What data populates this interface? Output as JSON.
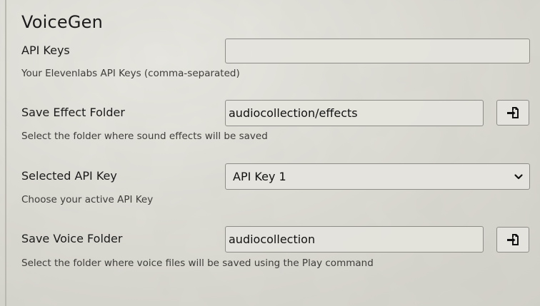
{
  "section": {
    "title": "VoiceGen"
  },
  "settings": [
    {
      "label": "API Keys",
      "hint": "Your Elevenlabs API Keys (comma-separated)",
      "value": ""
    },
    {
      "label": "Save Effect Folder",
      "hint": "Select the folder where sound effects will be saved",
      "value": "audiocollection/effects",
      "button_icon": "file-import-icon"
    },
    {
      "label": "Selected API Key",
      "hint": "Choose your active API Key",
      "selected": "API Key 1",
      "icon": "chevron-down-icon"
    },
    {
      "label": "Save Voice Folder",
      "hint": "Select the folder where voice files will be saved using the Play command",
      "value": "audiocollection",
      "button_icon": "file-import-icon"
    }
  ],
  "colors": {
    "background": "#deddd6",
    "field_border": "#8e8c86",
    "field_background": "#e4e3dd",
    "text": "#1b1b1b"
  }
}
